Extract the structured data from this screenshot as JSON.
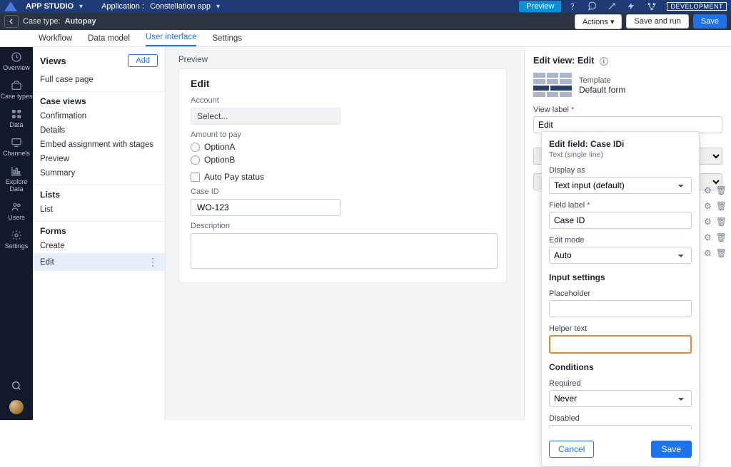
{
  "appbar": {
    "studio": "APP STUDIO",
    "app_prefix": "Application :",
    "app_name": "Constellation app",
    "preview": "Preview",
    "dev_badge": "DEVELOPMENT"
  },
  "subbar": {
    "case_type_prefix": "Case type:",
    "case_type": "Autopay",
    "actions": "Actions",
    "save_run": "Save and run",
    "save": "Save"
  },
  "tabs": [
    "Workflow",
    "Data model",
    "User interface",
    "Settings"
  ],
  "active_tab": "User interface",
  "rail": [
    "Overview",
    "Case types",
    "Data",
    "Channels",
    "Explore Data",
    "Users",
    "Settings"
  ],
  "views": {
    "title": "Views",
    "add": "Add",
    "full_case_page": "Full case page",
    "groups": [
      {
        "title": "Case views",
        "items": [
          "Confirmation",
          "Details",
          "Embed assignment with stages",
          "Preview",
          "Summary"
        ]
      },
      {
        "title": "Lists",
        "items": [
          "List"
        ]
      },
      {
        "title": "Forms",
        "items": [
          "Create",
          "Edit"
        ]
      }
    ],
    "selected": "Edit"
  },
  "preview": {
    "label": "Preview",
    "card_title": "Edit",
    "account_label": "Account",
    "account_placeholder": "Select...",
    "amount_label": "Amount to pay",
    "options": [
      "OptionA",
      "OptionB"
    ],
    "autopay_label": "Auto Pay status",
    "caseid_label": "Case ID",
    "caseid_value": "WO-123",
    "description_label": "Description"
  },
  "edit_view": {
    "heading_prefix": "Edit view:",
    "heading_name": "Edit",
    "template_label": "Template",
    "template_value": "Default form",
    "view_label_label": "View label",
    "view_label_value": "Edit"
  },
  "edit_field": {
    "heading_prefix": "Edit field:",
    "heading_name": "Case ID",
    "subtype": "Text (single line)",
    "display_as_label": "Display as",
    "display_as_value": "Text input (default)",
    "field_label_label": "Field label",
    "field_label_value": "Case ID",
    "edit_mode_label": "Edit mode",
    "edit_mode_value": "Auto",
    "input_settings": "Input settings",
    "placeholder_label": "Placeholder",
    "placeholder_value": "",
    "helper_label": "Helper text",
    "helper_value": "",
    "conditions": "Conditions",
    "required_label": "Required",
    "required_value": "Never",
    "disabled_label": "Disabled",
    "cancel": "Cancel",
    "save": "Save"
  }
}
